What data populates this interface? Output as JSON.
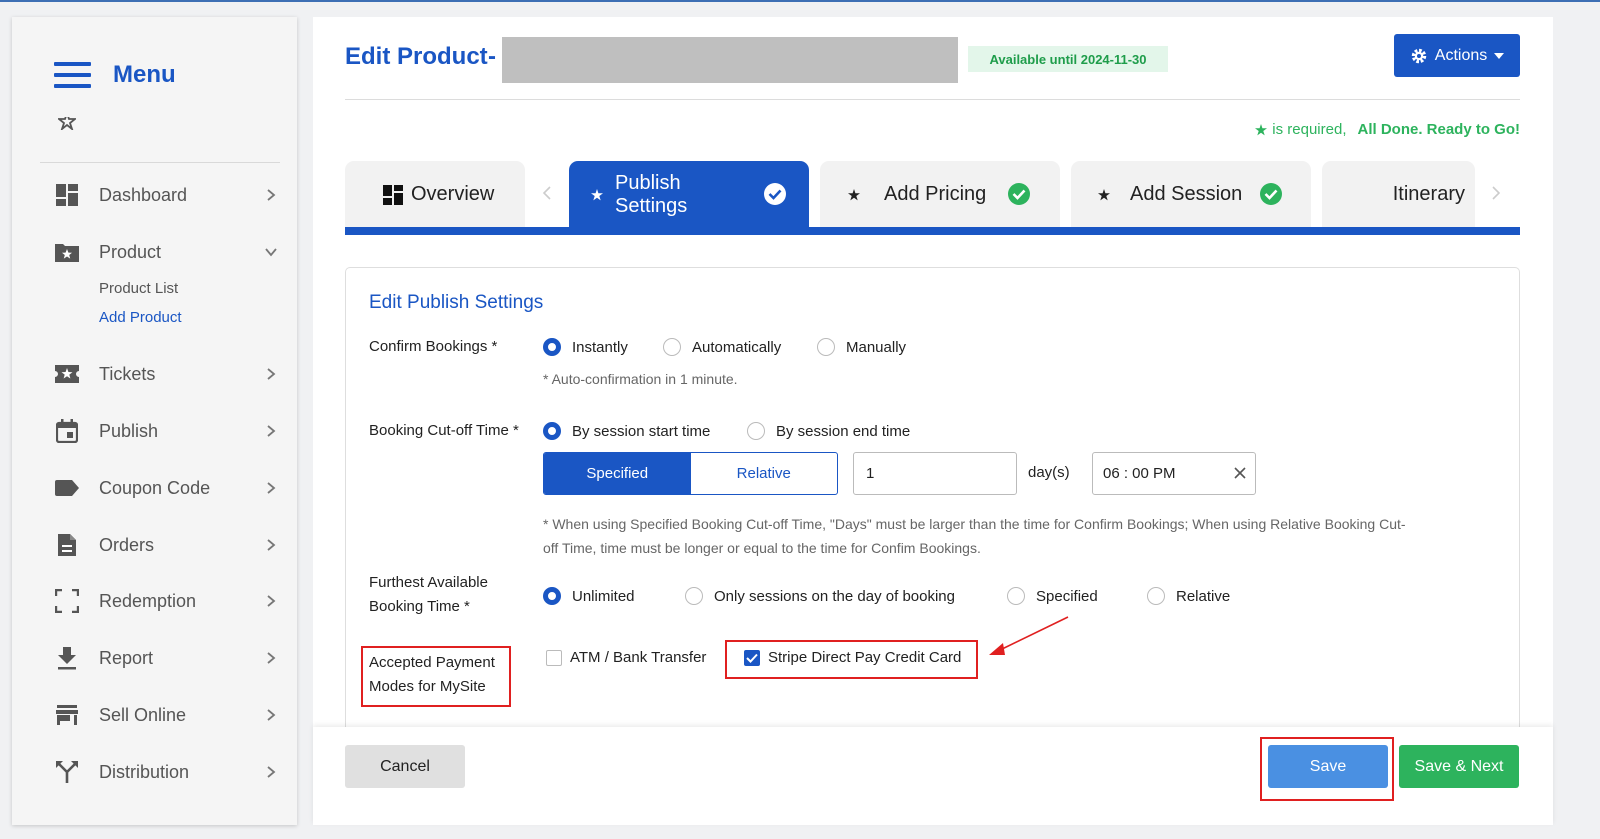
{
  "sidebar": {
    "title": "Menu",
    "items": [
      {
        "label": "Dashboard",
        "icon": "dashboard-icon"
      },
      {
        "label": "Product",
        "icon": "folder-star-icon",
        "expanded": true
      },
      {
        "label": "Tickets",
        "icon": "ticket-icon"
      },
      {
        "label": "Publish",
        "icon": "calendar-icon"
      },
      {
        "label": "Coupon Code",
        "icon": "tag-icon"
      },
      {
        "label": "Orders",
        "icon": "document-icon"
      },
      {
        "label": "Redemption",
        "icon": "scan-icon"
      },
      {
        "label": "Report",
        "icon": "download-icon"
      },
      {
        "label": "Sell Online",
        "icon": "store-icon"
      },
      {
        "label": "Distribution",
        "icon": "fork-icon"
      }
    ],
    "product_sub": [
      "Product List",
      "Add Product"
    ]
  },
  "header": {
    "title": "Edit Product",
    "dash": "-",
    "badge": "Available until 2024-11-30",
    "actions_label": "Actions",
    "required_text": "is required,",
    "done_text": "All Done. Ready to Go!"
  },
  "tabs": [
    {
      "label": "Overview"
    },
    {
      "label_line1": "Publish",
      "label_line2": "Settings",
      "active": true
    },
    {
      "label": "Add Pricing"
    },
    {
      "label": "Add Session"
    },
    {
      "label": "Itinerary"
    }
  ],
  "form": {
    "section_title": "Edit Publish Settings",
    "confirm": {
      "label": "Confirm Bookings *",
      "options": [
        "Instantly",
        "Automatically",
        "Manually"
      ],
      "selected": "Instantly",
      "note": "* Auto-confirmation in 1 minute."
    },
    "cutoff": {
      "label": "Booking Cut-off Time *",
      "options": [
        "By session start time",
        "By session end time"
      ],
      "selected": "By session start time",
      "mode_options": [
        "Specified",
        "Relative"
      ],
      "mode_selected": "Specified",
      "days_value": "1",
      "days_label": "day(s)",
      "time_value": "06 : 00 PM",
      "note_line1": "* When using Specified Booking Cut-off Time, \"Days\" must be larger than the time for Confirm Bookings; When using Relative Booking Cut-",
      "note_line2": "off Time, time must be longer or equal to the time for Confim Bookings."
    },
    "furthest": {
      "label_line1": "Furthest Available",
      "label_line2": "Booking Time *",
      "options": [
        "Unlimited",
        "Only sessions on the day of booking",
        "Specified",
        "Relative"
      ],
      "selected": "Unlimited"
    },
    "payment": {
      "label_line1": "Accepted Payment",
      "label_line2": "Modes for MySite",
      "options": [
        {
          "label": "ATM / Bank Transfer",
          "checked": false
        },
        {
          "label": "Stripe Direct Pay Credit Card",
          "checked": true
        }
      ]
    }
  },
  "footer": {
    "cancel": "Cancel",
    "save": "Save",
    "save_next": "Save & Next"
  },
  "colors": {
    "primary": "#1a56c4",
    "success": "#2db35d",
    "save": "#4a90e2",
    "highlight": "#e02020"
  }
}
